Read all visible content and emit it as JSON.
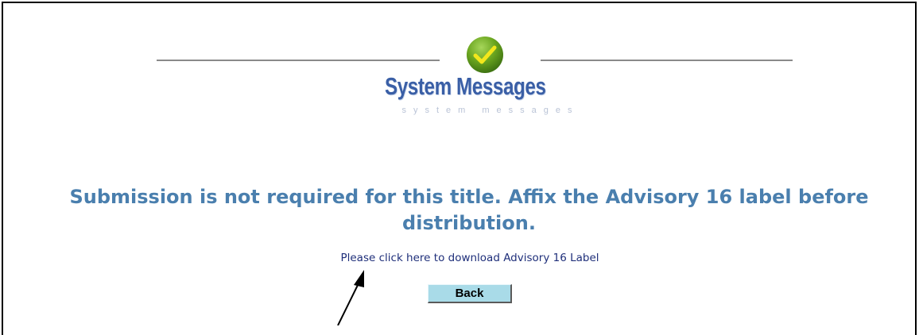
{
  "header": {
    "title": "System Messages",
    "subtitle": "system messages",
    "icon": "check-circle-icon",
    "icon_color": "#6aa51f",
    "check_color": "#f2e71c"
  },
  "message": {
    "text": "Submission is not required for this title. Affix the Advisory 16 label before distribution.",
    "color": "#4a7fae"
  },
  "download": {
    "prefix": "Please ",
    "link_text": "click here",
    "suffix": " to download Advisory 16 Label"
  },
  "actions": {
    "back_label": "Back"
  },
  "annotation": {
    "arrow": "pointer-arrow-icon"
  }
}
